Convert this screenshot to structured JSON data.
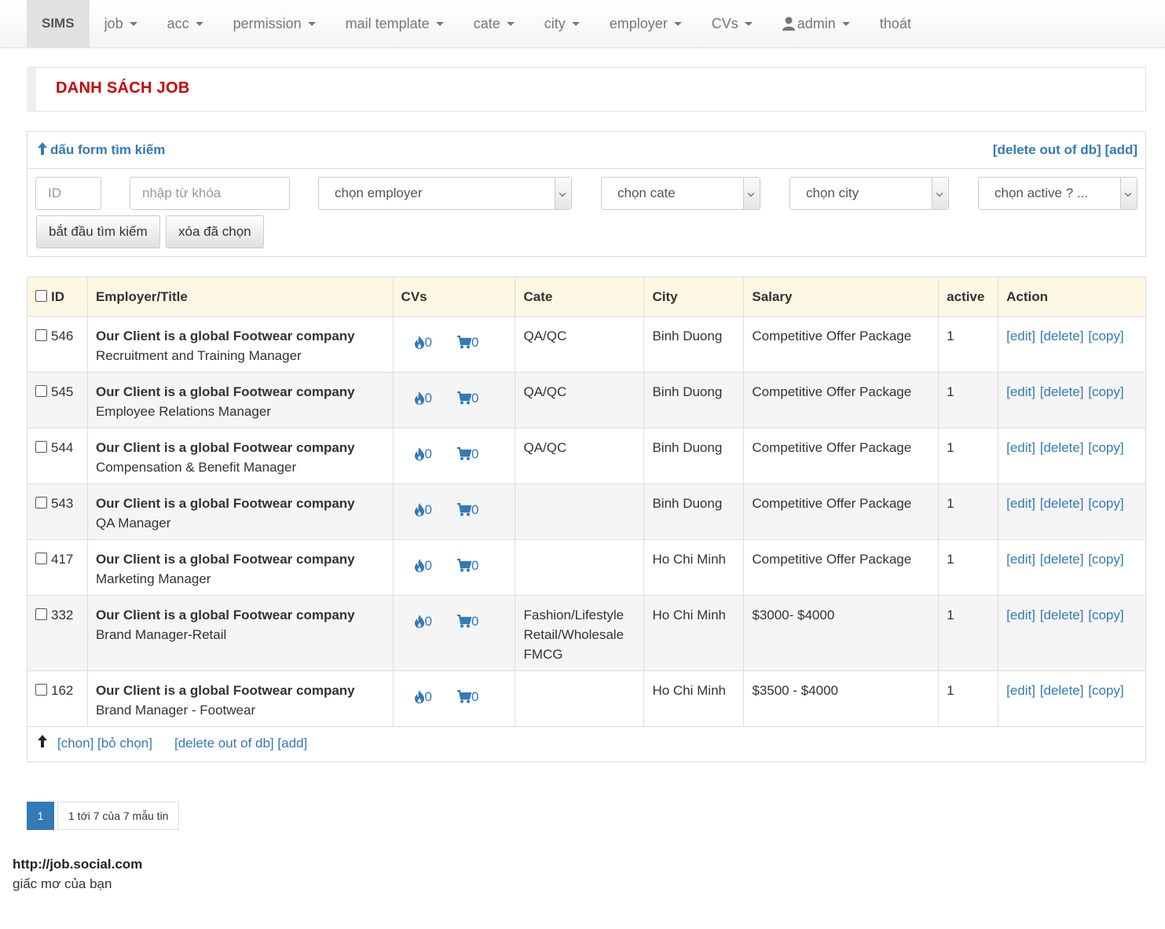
{
  "nav": {
    "brand": "SIMS",
    "items": [
      "job",
      "acc",
      "permission",
      "mail template",
      "cate",
      "city",
      "employer",
      "CVs"
    ],
    "user": "admin",
    "logout": "thoát"
  },
  "page_title": "DANH SÁCH JOB",
  "search": {
    "toggle": "dấu form tìm kiếm",
    "delete_link": "[delete out of db]",
    "add_link": "[add]",
    "id_placeholder": "ID",
    "keyword_placeholder": "nhập từ khóa",
    "employer_select": "chọn employer",
    "cate_select": "chọn cate",
    "city_select": "chọn city",
    "active_select": "chọn active ? ...",
    "search_button": "bắt đầu tìm kiếm",
    "clear_button": "xóa đã chọn"
  },
  "table": {
    "headers": [
      "ID",
      "Employer/Title",
      "CVs",
      "Cate",
      "City",
      "Salary",
      "active",
      "Action"
    ],
    "rows": [
      {
        "id": "546",
        "employer": "Our Client is a global Footwear company",
        "title": "Recruitment and Training Manager",
        "cv1": "0",
        "cv2": "0",
        "cate": "QA/QC",
        "city": "Binh Duong",
        "salary": "Competitive Offer Package",
        "active": "1"
      },
      {
        "id": "545",
        "employer": "Our Client is a global Footwear company",
        "title": "Employee Relations Manager",
        "cv1": "0",
        "cv2": "0",
        "cate": "QA/QC",
        "city": "Binh Duong",
        "salary": "Competitive Offer Package",
        "active": "1"
      },
      {
        "id": "544",
        "employer": "Our Client is a global Footwear company",
        "title": "Compensation & Benefit Manager",
        "cv1": "0",
        "cv2": "0",
        "cate": "QA/QC",
        "city": "Binh Duong",
        "salary": "Competitive Offer Package",
        "active": "1"
      },
      {
        "id": "543",
        "employer": "Our Client is a global Footwear company",
        "title": "QA Manager",
        "cv1": "0",
        "cv2": "0",
        "cate": "",
        "city": "Binh Duong",
        "salary": "Competitive Offer Package",
        "active": "1"
      },
      {
        "id": "417",
        "employer": "Our Client is a global Footwear company",
        "title": "Marketing Manager",
        "cv1": "0",
        "cv2": "0",
        "cate": "",
        "city": "Ho Chi Minh",
        "salary": "Competitive Offer Package",
        "active": "1"
      },
      {
        "id": "332",
        "employer": "Our Client is a global Footwear company",
        "title": "Brand Manager-Retail",
        "cv1": "0",
        "cv2": "0",
        "cate": "Fashion/Lifestyle\nRetail/Wholesale\nFMCG",
        "city": "Ho Chi Minh",
        "salary": "$3000- $4000",
        "active": "1"
      },
      {
        "id": "162",
        "employer": "Our Client is a global Footwear company",
        "title": "Brand Manager - Footwear",
        "cv1": "0",
        "cv2": "0",
        "cate": "",
        "city": "Ho Chi Minh",
        "salary": "$3500 - $4000",
        "active": "1"
      }
    ],
    "actions": {
      "edit": "[edit]",
      "delete": "[delete]",
      "copy": "[copy]"
    }
  },
  "table_footer": {
    "choose": "[chon]",
    "unchoose": "[bỏ chọn]",
    "delete_link": "[delete out of db]",
    "add_link": "[add]"
  },
  "pagination": {
    "current": "1",
    "info": "1 tới 7 của 7 mẫu tin"
  },
  "footer": {
    "url": "http://job.social.com",
    "tagline": "giấc mơ của bạn"
  },
  "colors": {
    "accent": "#337ab7",
    "title": "#cc0000",
    "header_bg": "#fcf8e3"
  }
}
